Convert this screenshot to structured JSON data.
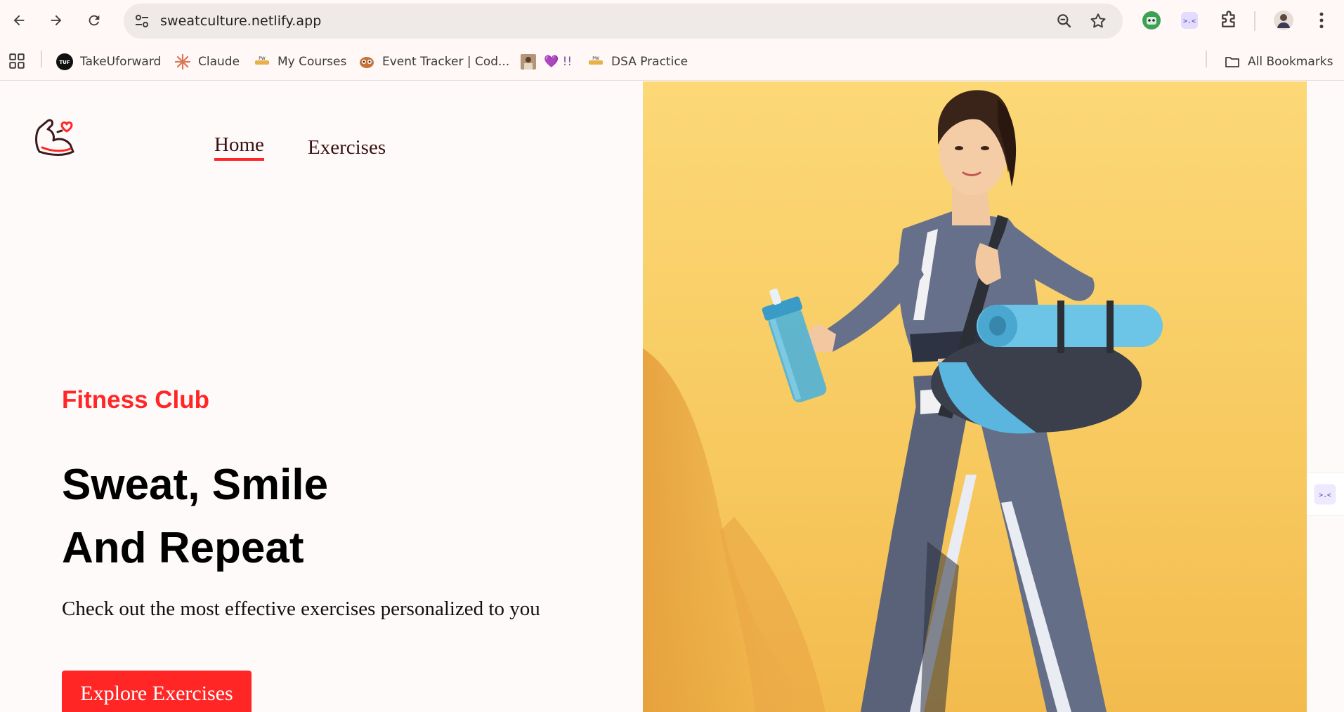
{
  "browser": {
    "url": "sweatculture.netlify.app",
    "bookmarks": [
      {
        "label": "TakeUforward",
        "icon": "tuf-icon"
      },
      {
        "label": "Claude",
        "icon": "claude-icon"
      },
      {
        "label": "My Courses",
        "icon": "course-icon"
      },
      {
        "label": "Event Tracker | Cod...",
        "icon": "owl-icon"
      },
      {
        "label": "💜 !!",
        "icon": "photo-icon"
      },
      {
        "label": "DSA Practice",
        "icon": "course-icon"
      }
    ],
    "all_bookmarks_label": "All Bookmarks"
  },
  "site": {
    "nav": {
      "home": "Home",
      "exercises": "Exercises"
    },
    "hero": {
      "eyebrow": "Fitness Club",
      "title_line1": "Sweat, Smile",
      "title_line2": "And Repeat",
      "subtitle": "Check out the most effective exercises personalized to you",
      "cta": "Explore Exercises"
    }
  },
  "colors": {
    "accent": "#ff2625",
    "hero_bg": "#fbcf6a",
    "page_bg": "#fffafa"
  }
}
